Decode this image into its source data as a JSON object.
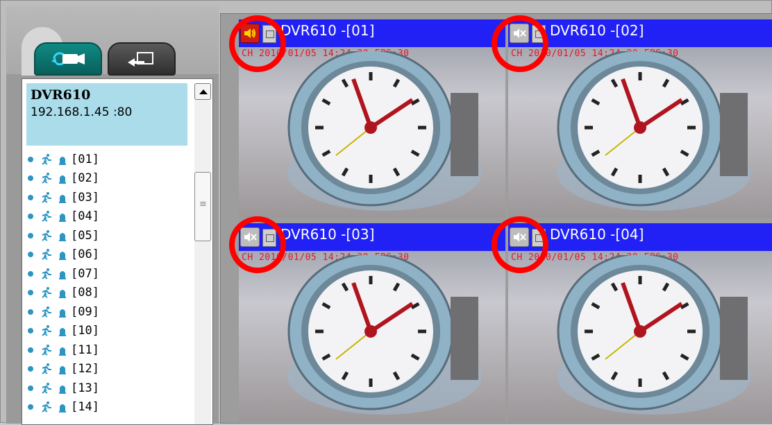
{
  "device": {
    "name": "DVR610",
    "address": "192.168.1.45 :80"
  },
  "channels": [
    "[01]",
    "[02]",
    "[03]",
    "[04]",
    "[05]",
    "[06]",
    "[07]",
    "[08]",
    "[09]",
    "[10]",
    "[11]",
    "[12]",
    "[13]",
    "[14]"
  ],
  "tiles": [
    {
      "title": "DVR610 -[01]",
      "osd": "CH 2010/01/05 14:24:20 FPS:30",
      "audio": "on"
    },
    {
      "title": "DVR610 -[02]",
      "osd": "CH 2010/01/05 14:24:20 FPS:30",
      "audio": "muted"
    },
    {
      "title": "DVR610 -[03]",
      "osd": "CH 2010/01/05 14:24:20 FPS:30",
      "audio": "muted"
    },
    {
      "title": "DVR610 -[04]",
      "osd": "CH 2010/01/05 14:24:20 FPS:30",
      "audio": "muted"
    }
  ],
  "colors": {
    "title_bar": "#2121f5",
    "highlight": "#ff0000",
    "audio_on": "#d01c13",
    "device_header": "#aadcea",
    "status_dot": "#2b95c4"
  },
  "icons": {
    "tab_camera": "camera-refresh-icon",
    "tab_export": "export-icon",
    "audio_on": "speaker-on-icon",
    "audio_muted": "speaker-muted-icon",
    "snapshot": "snapshot-icon",
    "motion": "motion-icon",
    "alarm": "alarm-icon"
  }
}
